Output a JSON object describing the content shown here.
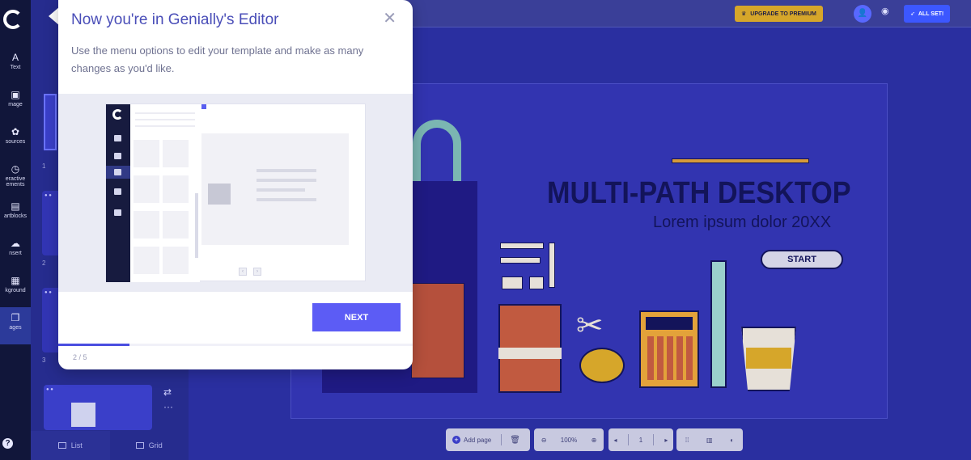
{
  "rail": {
    "items": [
      {
        "label": "Text",
        "icon": "text-icon"
      },
      {
        "label": "Image",
        "icon": "image-icon"
      },
      {
        "label": "Resources",
        "icon": "resources-icon"
      },
      {
        "label": "Interactive elements",
        "icon": "interactive-icon"
      },
      {
        "label": "Smartblocks",
        "icon": "smartblocks-icon"
      },
      {
        "label": "Insert",
        "icon": "insert-icon"
      },
      {
        "label": "Background",
        "icon": "background-icon"
      },
      {
        "label": "Pages",
        "icon": "pages-icon"
      }
    ],
    "rail_labels_visible": [
      "Text",
      "mage",
      "sources",
      "eractive\nements",
      "artblocks",
      "nsert",
      "kground",
      "ages"
    ],
    "help_label": "?"
  },
  "pages": {
    "numbers": [
      "1",
      "2",
      "3"
    ],
    "footer": {
      "list_label": "List",
      "grid_label": "Grid"
    }
  },
  "topbar": {
    "upgrade_label": "UPGRADE TO PREMIUM",
    "allset_label": "ALL SET!"
  },
  "slide": {
    "title": "MULTI-PATH DESKTOP",
    "subtitle": "Lorem ipsum dolor 20XX",
    "start_label": "START"
  },
  "bottombar": {
    "add_page_label": "Add page",
    "zoom": "100%",
    "page_number": "1"
  },
  "popover": {
    "title": "Now you're in Genially's Editor",
    "body": "Use the menu options to edit your template and make as many changes as you'd like.",
    "next_label": "NEXT",
    "step": "2 / 5",
    "progress": 0.2
  },
  "colors": {
    "accent": "#5c5cf5",
    "rail_bg": "#11163a",
    "canvas_bg": "#2a2fa0",
    "upgrade_bg": "#d6a62a"
  }
}
